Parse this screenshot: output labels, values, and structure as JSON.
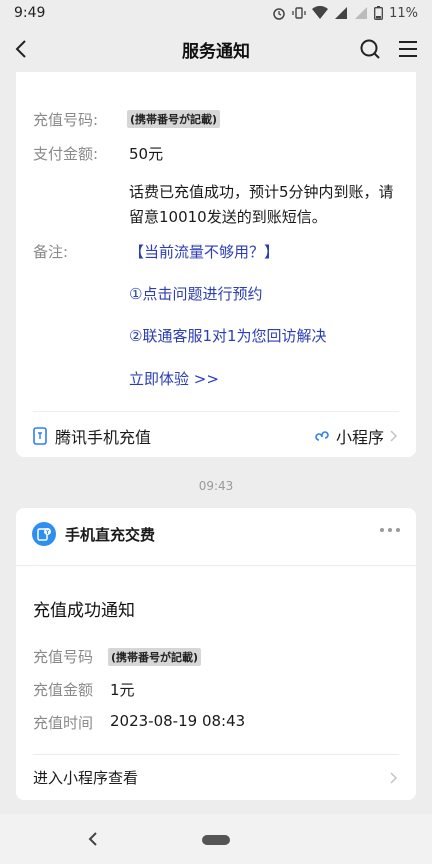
{
  "status_bar": {
    "time": "9:49",
    "battery": "11%"
  },
  "nav": {
    "title": "服务通知"
  },
  "card1": {
    "recharge_number_label": "充值号码:",
    "recharge_number_value": "(携帯番号が記載)",
    "amount_label": "支付金额:",
    "amount_value": "50元",
    "message": "话费已充值成功，预计5分钟内到账，请留意10010发送的到账短信。",
    "remark_label": "备注:",
    "remark_line1": "【当前流量不够用？】",
    "remark_line2": "①点击问题进行预约",
    "remark_line3": "②联通客服1对1为您回访解决",
    "remark_link": "立即体验 >>",
    "source_name": "腾讯手机充值",
    "mini_program_label": "小程序"
  },
  "time_separator": "09:43",
  "card2": {
    "app_name": "手机直充交费",
    "title": "充值成功通知",
    "rows": [
      {
        "label": "充值号码",
        "value": "(携帯番号が記載)"
      },
      {
        "label": "充值金额",
        "value": "1元"
      },
      {
        "label": "充值时间",
        "value": "2023-08-19 08:43"
      }
    ],
    "footer_link": "进入小程序查看"
  }
}
